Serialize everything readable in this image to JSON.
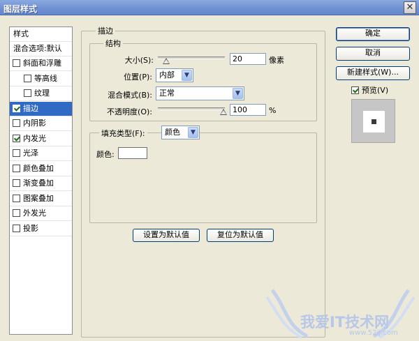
{
  "window": {
    "title": "图层样式",
    "close_glyph": "✕"
  },
  "style_list": {
    "header": "样式",
    "blend_options": "混合选项:默认",
    "items": [
      {
        "label": "斜面和浮雕",
        "checked": false
      },
      {
        "label": "等高线",
        "checked": false,
        "sub": true
      },
      {
        "label": "纹理",
        "checked": false,
        "sub": true
      },
      {
        "label": "描边",
        "checked": true,
        "selected": true
      },
      {
        "label": "内阴影",
        "checked": false
      },
      {
        "label": "内发光",
        "checked": true
      },
      {
        "label": "光泽",
        "checked": false
      },
      {
        "label": "颜色叠加",
        "checked": false
      },
      {
        "label": "渐变叠加",
        "checked": false
      },
      {
        "label": "图案叠加",
        "checked": false
      },
      {
        "label": "外发光",
        "checked": false
      },
      {
        "label": "投影",
        "checked": false
      }
    ]
  },
  "stroke": {
    "group_title": "描边",
    "structure": {
      "title": "结构",
      "size_label": "大小(S):",
      "size_value": "20",
      "size_unit": "像素",
      "position_label": "位置(P):",
      "position_value": "内部",
      "blend_label": "混合模式(B):",
      "blend_value": "正常",
      "opacity_label": "不透明度(O):",
      "opacity_value": "100",
      "opacity_unit": "%"
    },
    "fill": {
      "type_label": "填充类型(F):",
      "type_value": "颜色",
      "color_label": "颜色:",
      "color_value": "#ffffff"
    },
    "set_default": "设置为默认值",
    "reset_default": "复位为默认值"
  },
  "buttons": {
    "ok": "确定",
    "cancel": "取消",
    "new_style": "新建样式(W)...",
    "preview_label": "预览(V)",
    "preview_checked": true
  },
  "watermark": {
    "text": "我爱IT技术网",
    "url": "www.52ij.com"
  },
  "colors": {
    "titlebar": "#6f8fd3",
    "selection": "#316ac5",
    "dialog_bg": "#ece9d8"
  }
}
